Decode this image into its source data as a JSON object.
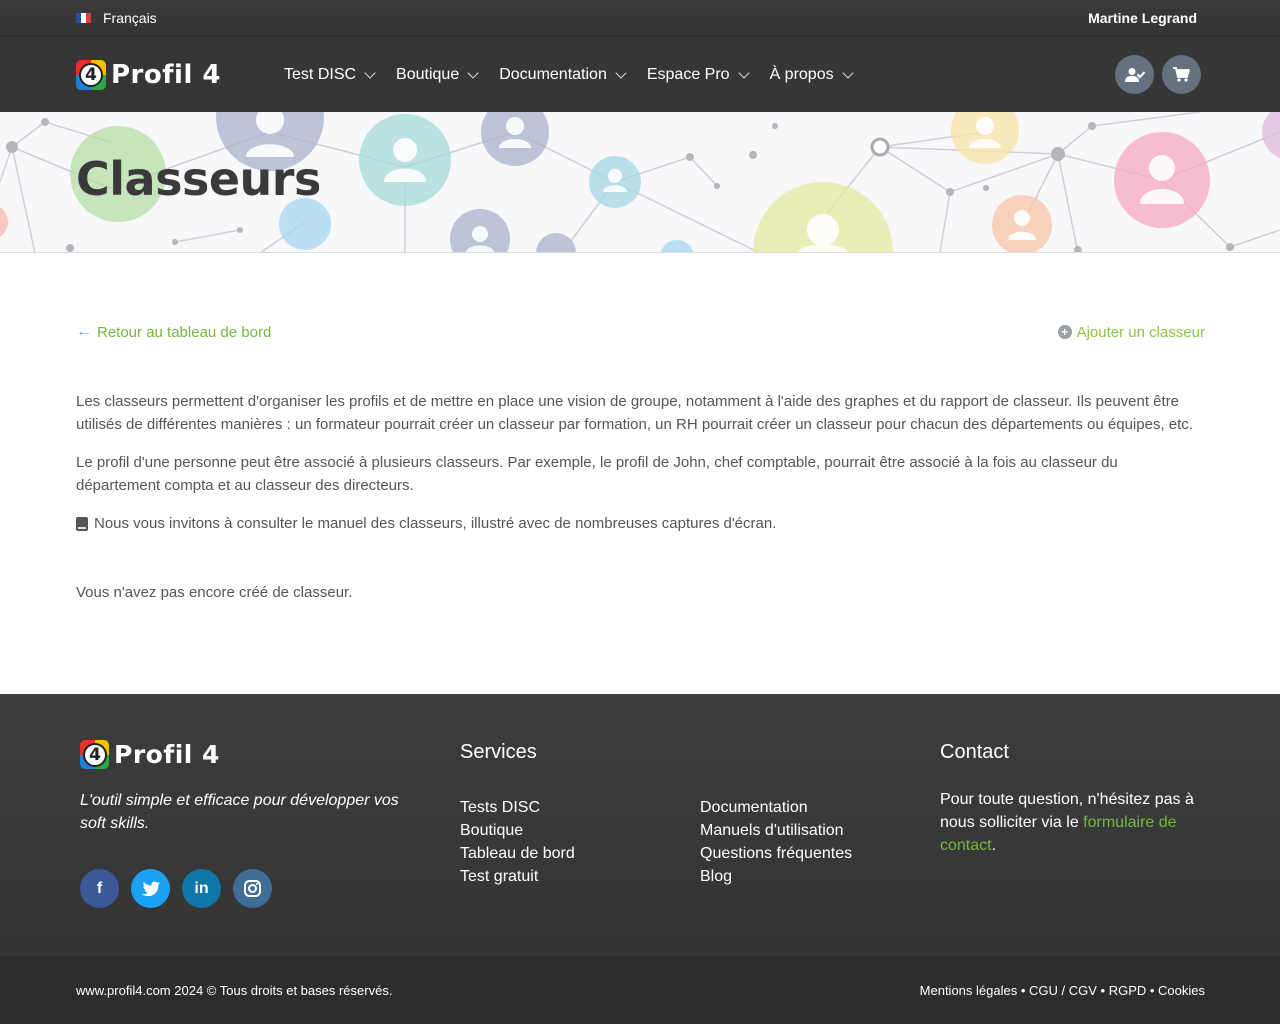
{
  "topbar": {
    "language": "Français",
    "user_name": "Martine Legrand"
  },
  "brand": {
    "logo_digit": "4",
    "name": "Profil 4",
    "colors": [
      "#e8302a",
      "#f5c200",
      "#1f7fd8",
      "#2ea84a"
    ]
  },
  "nav": {
    "items": [
      {
        "label": "Test DISC"
      },
      {
        "label": "Boutique"
      },
      {
        "label": "Documentation"
      },
      {
        "label": "Espace Pro"
      },
      {
        "label": "À propos"
      }
    ],
    "icons": [
      "user-check-icon",
      "cart-icon"
    ]
  },
  "hero": {
    "title": "Classeurs"
  },
  "actions": {
    "back_label": "Retour au tableau de bord",
    "add_label": "Ajouter un classeur"
  },
  "content": {
    "paragraph1": "Les classeurs permettent d'organiser les profils et de mettre en place une vision de groupe, notamment à l'aide des graphes et du rapport de classeur. Ils peuvent être utilisés de différentes manières : un formateur pourrait créer un classeur par formation, un RH pourrait créer un classeur pour chacun des départements ou équipes, etc.",
    "paragraph2": "Le profil d'une personne peut être associé à plusieurs classeurs. Par exemple, le profil de John, chef comptable, pourrait être associé à la fois au classeur du département compta et au classeur des directeurs.",
    "manual_note": "Nous vous invitons à consulter le manuel des classeurs, illustré avec de nombreuses captures d'écran.",
    "empty_message": "Vous n'avez pas encore créé de classeur."
  },
  "footer": {
    "tagline": "L'outil simple et efficace pour développer vos soft skills.",
    "socials": [
      {
        "name": "facebook",
        "glyph": "f",
        "color": "#3b5998"
      },
      {
        "name": "twitter",
        "glyph": "t",
        "color": "#1da1f2"
      },
      {
        "name": "linkedin",
        "glyph": "in",
        "color": "#0e76a8"
      },
      {
        "name": "instagram",
        "glyph": "◎",
        "color": "#3f6d95"
      }
    ],
    "services_heading": "Services",
    "services_col1": [
      "Tests DISC",
      "Boutique",
      "Tableau de bord",
      "Test gratuit"
    ],
    "services_col2": [
      "Documentation",
      "Manuels d'utilisation",
      "Questions fréquentes",
      "Blog"
    ],
    "contact_heading": "Contact",
    "contact_text_before": "Pour toute question, n'hésitez pas à nous solliciter via le ",
    "contact_link": "formulaire de contact",
    "contact_text_after": "."
  },
  "bottombar": {
    "copyright": "www.profil4.com 2024 © Tous droits et bases réservés.",
    "legal_links": [
      "Mentions légales",
      "CGU / CGV",
      "RGPD",
      "Cookies"
    ],
    "separator": " • "
  },
  "colors": {
    "accent_green": "#74b843",
    "dark_bg": "#363636"
  }
}
